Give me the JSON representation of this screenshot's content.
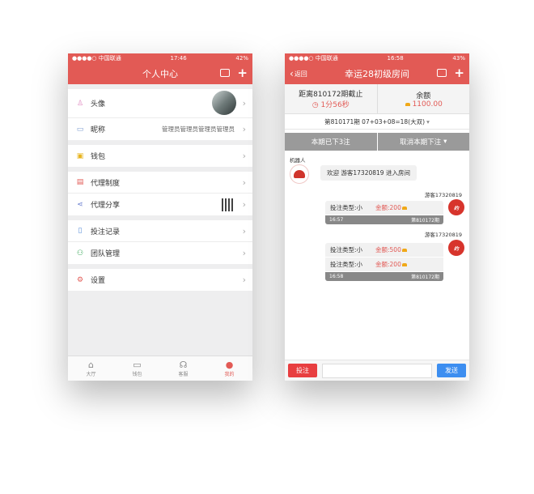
{
  "status": {
    "carrier": "●●●●○ 中国联通",
    "left_time": "17:46",
    "left_battery": "42%",
    "right_time": "16:58",
    "right_battery": "43%"
  },
  "left": {
    "title": "个人中心",
    "rows": {
      "avatar": "头像",
      "nickname": "昵称",
      "nickname_value": "管理员管理员管理员管理员",
      "wallet": "钱包",
      "agent_system": "代理制度",
      "agent_share": "代理分享",
      "bet_records": "投注记录",
      "team": "团队管理",
      "settings": "设置"
    },
    "tabs": {
      "hall": "大厅",
      "wallet": "钱包",
      "service": "客服",
      "mine": "我的"
    }
  },
  "right": {
    "back": "返回",
    "title": "幸运28初级房间",
    "deadline_label": "距离810172期截止",
    "countdown": "1分56秒",
    "balance_label": "余额",
    "balance": "1100.00",
    "last_result": "第810171期 07+03+08=18(大双)",
    "placed": "本期已下3注",
    "cancel": "取消本期下注",
    "bot_name": "机器人",
    "bot_message": "欢迎 游客17320819 进入房间",
    "user_name": "游客17320819",
    "avatar_text": "约",
    "bet_type_label": "投注类型:",
    "bet_type": "小",
    "amount_label": "金额:",
    "msg1": {
      "amount": "200",
      "time": "16:57",
      "period": "第810172期"
    },
    "msg2": {
      "amount1": "500",
      "amount2": "200",
      "time": "16:58",
      "period": "第810172期"
    },
    "bet_button": "投注",
    "send_button": "发送"
  }
}
